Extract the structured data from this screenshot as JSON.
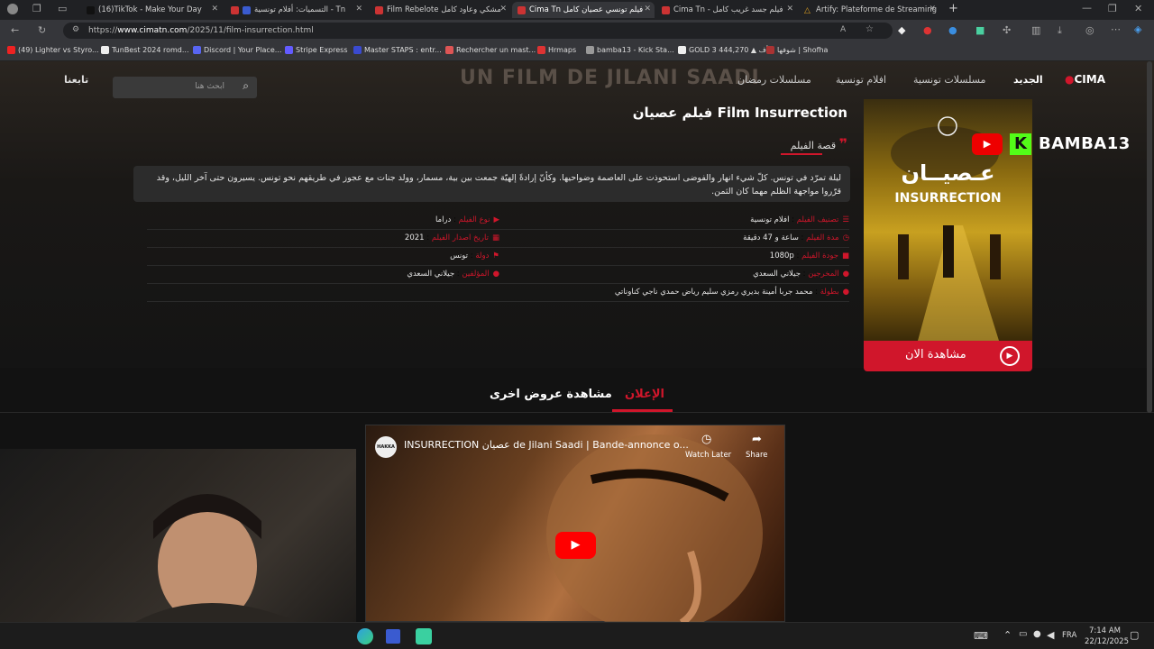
{
  "browser": {
    "tabs": [
      {
        "label": "(16)TikTok - Make Your Day",
        "active": false
      },
      {
        "label": "التسميات: أفلام تونسية - Tn",
        "active": false
      },
      {
        "label": "Film Rebelote مشكي وعاود كامل",
        "active": false
      },
      {
        "label": "Cima Tn فيلم تونسي عصيان كامل",
        "active": true
      },
      {
        "label": "Cima Tn - فيلم جسد غريب كامل",
        "active": false
      },
      {
        "label": "Artify: Plateforme de Streaming",
        "active": false
      }
    ],
    "url_prefix": "https://",
    "url_host": "www.cimatn.com",
    "url_path": "/2025/11/film-insurrection.html",
    "bookmarks": [
      "(49) Lighter vs Styro...",
      "TunBest 2024 romd...",
      "Discord | Your Place...",
      "Stripe Express",
      "Master STAPS : entr...",
      "Rechercher un mast...",
      "Hrmaps",
      "bamba13 - Kick Sta...",
      "GOLD 3 444,270 ▲ أف...",
      "شوفها | Shofha"
    ]
  },
  "site": {
    "logo": "CIMA",
    "nav": [
      "الجديد",
      "مسلسلات تونسية",
      "افلام تونسية",
      "مسلسلات رمضان"
    ],
    "follow": "تابعنا",
    "search_placeholder": "ابحث هنا",
    "bg_title": "UN FILM DE JILANI SAADI",
    "overlay_brand": "BAMBA13"
  },
  "movie": {
    "title": "فيلم عصيان Film Insurrection",
    "story_heading": "قصة الفيلم",
    "story": "ليلة تمرّد في تونس. كلّ شيء انهار والفوضى استحوذت على العاصمة وضواحيها. وكأنّ إرادةً إلهيّة جمعت بين بية، مسمار، وولد جنات مع عجوز في طريقهم نحو تونس. يسيرون حتى آخر الليل، وقد قرّروا مواجهة الظلم مهما كان الثمن.",
    "poster_title_ar": "عـصيــان",
    "poster_title_en": "INSURRECTION",
    "watch_now": "مشاهدة الان",
    "info": [
      {
        "label": "تصنيف الفيلم",
        "value": "افلام تونسية",
        "side": "right",
        "row": 0
      },
      {
        "label": "نوع الفيلم",
        "value": "دراما",
        "side": "left",
        "row": 0
      },
      {
        "label": "مدة الفيلم",
        "value": "ساعة و 47 دقيقة",
        "side": "right",
        "row": 1
      },
      {
        "label": "تاريخ اصدار الفيلم",
        "value": "2021",
        "side": "left",
        "row": 1
      },
      {
        "label": "جودة الفيلم",
        "value": "1080p",
        "side": "right",
        "row": 2
      },
      {
        "label": "دولة",
        "value": "تونس",
        "side": "left",
        "row": 2
      },
      {
        "label": "المخرجين",
        "value": "جيلاني السعدي",
        "side": "right",
        "row": 3
      },
      {
        "label": "المؤلفين",
        "value": "جيلاني السعدي",
        "side": "left",
        "row": 3
      },
      {
        "label": "بطولة",
        "value": "محمد جربا  أمينة بديري  رمزي سليم  رياض حمدي  ناجي كناوناتي",
        "side": "right",
        "row": 4
      }
    ],
    "tab_trailer": "الإعلان",
    "tab_other": "مشاهدة عروض اخرى"
  },
  "video": {
    "channel": "HAKKA",
    "title": "INSURRECTION عصيان de Jilani Saadi | Bande-annonce o...",
    "watch_later": "Watch Later",
    "share": "Share"
  },
  "taskbar": {
    "lang": "FRA",
    "time": "7:14 AM",
    "date": "22/12/2025"
  },
  "colors": {
    "accent": "#d0162b",
    "kick": "#53fc18"
  }
}
